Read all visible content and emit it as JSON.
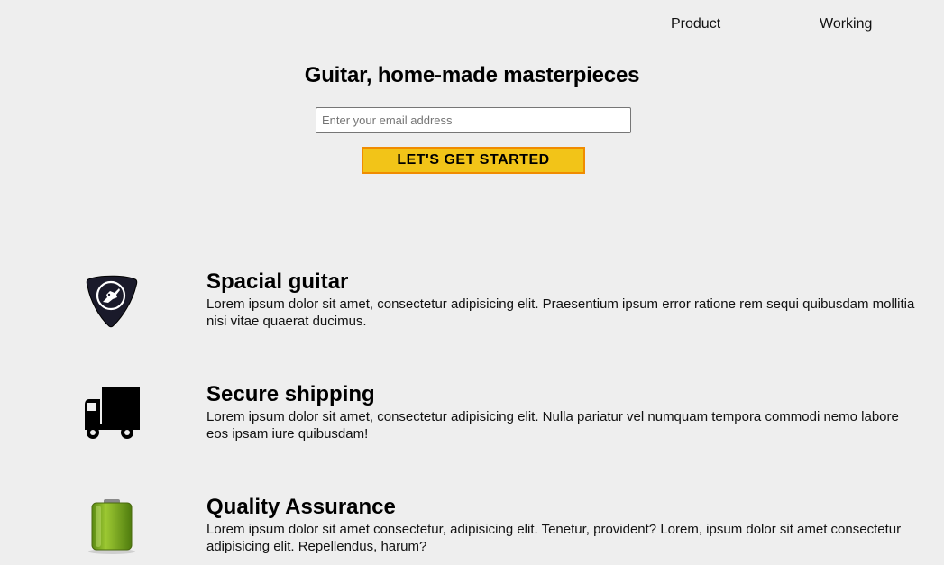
{
  "nav": {
    "items": [
      {
        "label": "Product"
      },
      {
        "label": "Working"
      }
    ]
  },
  "hero": {
    "title": "Guitar, home-made masterpieces",
    "email_placeholder": "Enter your email address",
    "cta_label": "LET'S GET STARTED"
  },
  "features": [
    {
      "title": "Spacial guitar",
      "description": "Lorem ipsum dolor sit amet, consectetur adipisicing elit. Praesentium ipsum error ratione rem sequi quibusdam mollitia nisi vitae quaerat ducimus.",
      "icon": "guitar-pick-icon"
    },
    {
      "title": "Secure shipping",
      "description": "Lorem ipsum dolor sit amet, consectetur adipisicing elit. Nulla pariatur vel numquam tempora commodi nemo labore eos ipsam iure quibusdam!",
      "icon": "truck-icon"
    },
    {
      "title": "Quality Assurance",
      "description": "Lorem ipsum dolor sit amet consectetur, adipisicing elit. Tenetur, provident? Lorem, ipsum dolor sit amet consectetur adipisicing elit. Repellendus, harum?",
      "icon": "battery-icon"
    }
  ],
  "colors": {
    "background": "#eeeeee",
    "cta_fill": "#f2c418",
    "cta_border": "#f08c00",
    "battery_green": "#7aa822"
  }
}
